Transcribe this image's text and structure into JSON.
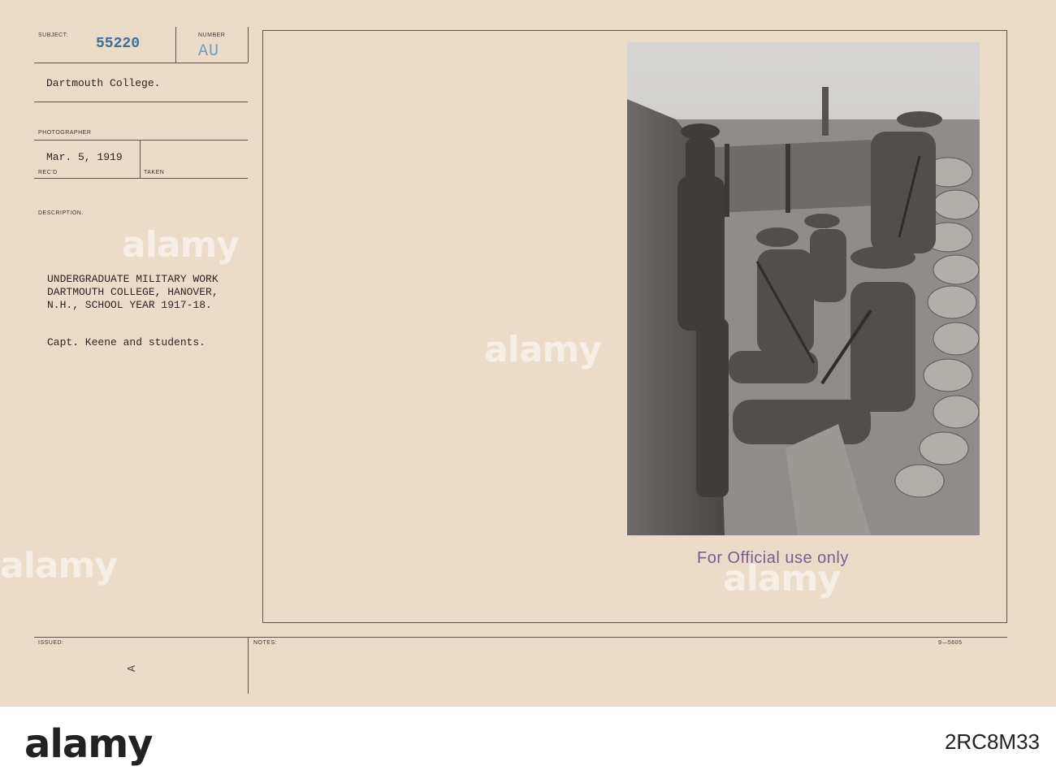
{
  "card": {
    "labels": {
      "subject": "SUBJECT:",
      "number": "NUMBER",
      "photographer": "PHOTOGRAPHER",
      "recd": "REC'D",
      "taken": "TAKEN",
      "description": "DESCRIPTION.",
      "issued": "ISSUED:",
      "notes": "NOTES:"
    },
    "stamp_number": "55220",
    "stamp_letters": "AU",
    "subject": "Dartmouth College.",
    "recd_date": "Mar. 5, 1919",
    "description_lines": [
      "UNDERGRADUATE MILITARY WORK",
      "DARTMOUTH COLLEGE, HANOVER,",
      "N.H., SCHOOL YEAR 1917-18."
    ],
    "caption": "Capt. Keene and students.",
    "official_stamp": "For Official use only",
    "form_number": "9—5605",
    "arrow_mark": "A"
  },
  "photo": {
    "subject": "Soldiers and students in a sandbagged trench"
  },
  "watermark": {
    "text": "alamy"
  },
  "footer": {
    "logo": "alamy",
    "image_id": "2RC8M33"
  }
}
